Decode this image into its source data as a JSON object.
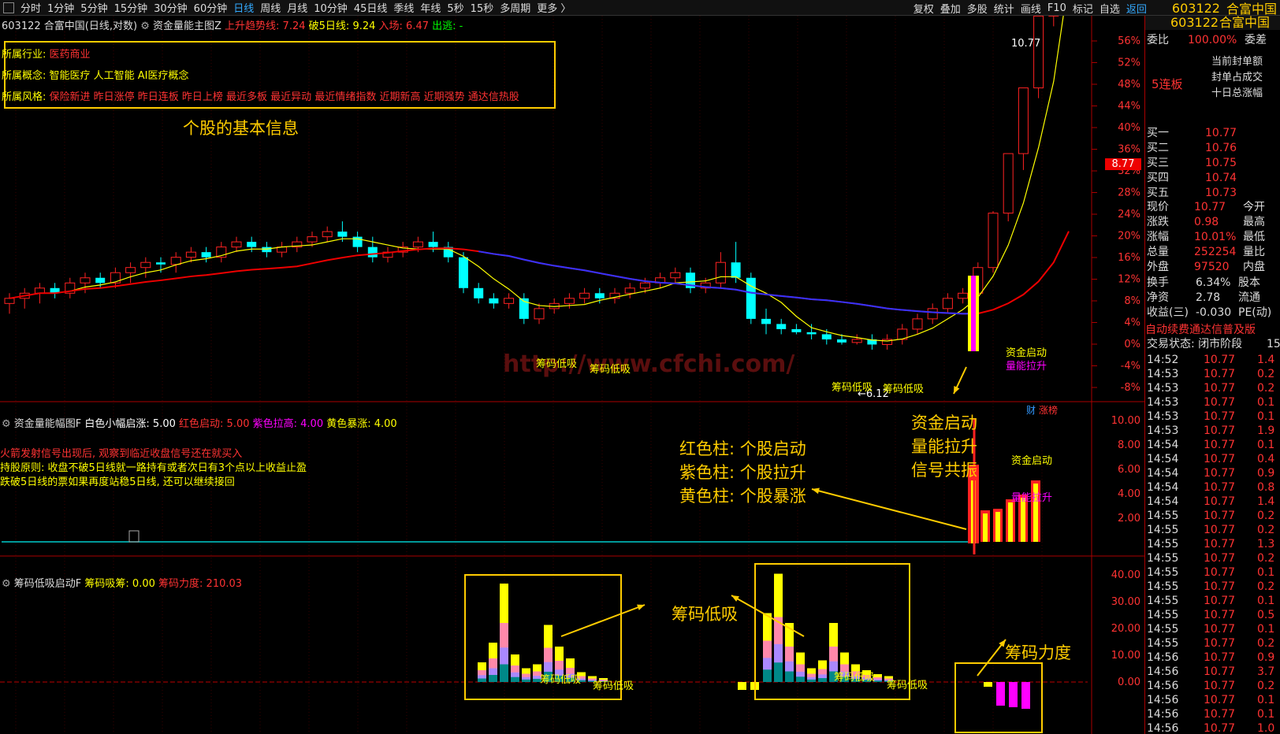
{
  "topbar": {
    "tabs": [
      "分时",
      "1分钟",
      "5分钟",
      "15分钟",
      "30分钟",
      "60分钟",
      "日线",
      "周线",
      "月线",
      "10分钟",
      "45日线",
      "季线",
      "年线",
      "5秒",
      "15秒",
      "多周期",
      "更多 〉"
    ],
    "active_tab": "日线",
    "tools": [
      "复权",
      "叠加",
      "多股",
      "统计",
      "画线",
      "F10",
      "标记",
      "自选",
      "返回"
    ],
    "stock_code": "603122",
    "stock_name": "合富中国"
  },
  "main_panel": {
    "header_code": "603122",
    "header_name": "合富中国(日线,对数)",
    "indicator_name": "资金量能主图Z",
    "up_trend_label": "上升趋势线: 7.24",
    "break5_label": "破5日线: 9.24",
    "entry_label": "入场: 6.47",
    "exit_label": "出逃: -",
    "info_lines": [
      {
        "label": "所属行业:",
        "value": "医药商业"
      },
      {
        "label": "所属概念:",
        "value": "智能医疗 人工智能 AI医疗概念"
      },
      {
        "label": "所属风格:",
        "value": "保险新进 昨日涨停 昨日连板 昨日上榜 最近多板 最近异动 最近情绪指数 近期新高 近期强势 通达信热股"
      }
    ],
    "info_caption": "个股的基本信息",
    "price_high_label": "10.77",
    "price_low_label": "←6.12",
    "price_marker": "8.77",
    "watermark": "http://www.cfchi.com/",
    "label_chip1": "筹码低吸",
    "label_chip2": "筹码低吸",
    "label_chip3": "筹码低吸",
    "label_chip4": "筹码低吸",
    "label_start": "资金启动",
    "label_lift": "量能拉升",
    "corner_tag1": "财",
    "corner_tag2": "涨榜"
  },
  "main_axis": [
    "56%",
    "52%",
    "48%",
    "44%",
    "40%",
    "36%",
    "32%",
    "28%",
    "24%",
    "20%",
    "16%",
    "12%",
    "8%",
    "4%",
    "0%",
    "-4%",
    "-8%"
  ],
  "mid_panel": {
    "title": "资金量能幅图F",
    "white_label": "白色小幅启涨: 5.00",
    "red_label": "红色启动: 5.00",
    "purple_label": "紫色拉高: 4.00",
    "yellow_label": "黄色暴涨: 4.00",
    "note1": "火箭发射信号出现后, 观察到临近收盘信号还在就买入",
    "note2": "持股原则: 收盘不破5日线就一路持有或者次日有3个点以上收益止盈",
    "note3": "跌破5日线的票如果再度站稳5日线, 还可以继续接回",
    "legend1": "红色柱: 个股启动",
    "legend2": "紫色柱: 个股拉升",
    "legend3": "黄色柱: 个股暴涨",
    "callout1": "资金启动",
    "callout2": "量能拉升",
    "callout3": "信号共振",
    "signal_start": "资金启动",
    "signal_lift": "量能拉升",
    "axis": [
      "10.00",
      "8.00",
      "6.00",
      "4.00",
      "2.00"
    ]
  },
  "low_panel": {
    "title": "筹码低吸启动F",
    "absorb_label": "筹码吸筹: 0.00",
    "force_label": "筹码力度: 210.03",
    "callout_absorb": "筹码低吸",
    "callout_force": "筹码力度",
    "inner_label1": "筹码低吸",
    "inner_label2": "筹码低吸",
    "inner_label3": "筹码低吸",
    "inner_label4": "筹码低吸",
    "axis": [
      "40.00",
      "30.00",
      "20.00",
      "10.00",
      "0.00"
    ]
  },
  "right_panel": {
    "code": "603122",
    "name": "合富中国",
    "weibi_label": "委比",
    "weibi_value": "100.00%",
    "weicha_label": "委差",
    "seal_amount": "当前封单额",
    "seal_ratio": "封单占成交",
    "ten_day": "十日总涨幅",
    "board": "5连板",
    "bids": [
      {
        "label": "买一",
        "price": "10.77"
      },
      {
        "label": "买二",
        "price": "10.76"
      },
      {
        "label": "买三",
        "price": "10.75"
      },
      {
        "label": "买四",
        "price": "10.74"
      },
      {
        "label": "买五",
        "price": "10.73"
      }
    ],
    "stats": [
      {
        "k": "现价",
        "v": "10.77",
        "k2": "今开"
      },
      {
        "k": "涨跌",
        "v": "0.98",
        "k2": "最高"
      },
      {
        "k": "涨幅",
        "v": "10.01%",
        "k2": "最低"
      },
      {
        "k": "总量",
        "v": "252254",
        "k2": "量比"
      },
      {
        "k": "外盘",
        "v": "97520",
        "k2": "内盘"
      }
    ],
    "stats2": [
      {
        "k": "换手",
        "v": "6.34%",
        "k2": "股本"
      },
      {
        "k": "净资",
        "v": "2.78",
        "k2": "流通"
      },
      {
        "k": "收益(三)",
        "v": "-0.030",
        "k2": "PE(动)"
      }
    ],
    "ticker_msg": "自动续费通达信普及版",
    "trade_state": "交易状态: 闭市阶段",
    "trade_state_num": "15",
    "ticks": [
      {
        "t": "14:52",
        "p": "10.77",
        "v": "1.4"
      },
      {
        "t": "14:53",
        "p": "10.77",
        "v": "0.2"
      },
      {
        "t": "14:53",
        "p": "10.77",
        "v": "0.2"
      },
      {
        "t": "14:53",
        "p": "10.77",
        "v": "0.1"
      },
      {
        "t": "14:53",
        "p": "10.77",
        "v": "0.1"
      },
      {
        "t": "14:53",
        "p": "10.77",
        "v": "1.9"
      },
      {
        "t": "14:54",
        "p": "10.77",
        "v": "0.1"
      },
      {
        "t": "14:54",
        "p": "10.77",
        "v": "0.4"
      },
      {
        "t": "14:54",
        "p": "10.77",
        "v": "0.9"
      },
      {
        "t": "14:54",
        "p": "10.77",
        "v": "0.8"
      },
      {
        "t": "14:54",
        "p": "10.77",
        "v": "1.4"
      },
      {
        "t": "14:55",
        "p": "10.77",
        "v": "0.2"
      },
      {
        "t": "14:55",
        "p": "10.77",
        "v": "0.2"
      },
      {
        "t": "14:55",
        "p": "10.77",
        "v": "1.3"
      },
      {
        "t": "14:55",
        "p": "10.77",
        "v": "0.2"
      },
      {
        "t": "14:55",
        "p": "10.77",
        "v": "0.1"
      },
      {
        "t": "14:55",
        "p": "10.77",
        "v": "0.2"
      },
      {
        "t": "14:55",
        "p": "10.77",
        "v": "0.1"
      },
      {
        "t": "14:55",
        "p": "10.77",
        "v": "0.5"
      },
      {
        "t": "14:55",
        "p": "10.77",
        "v": "0.1"
      },
      {
        "t": "14:55",
        "p": "10.77",
        "v": "0.2"
      },
      {
        "t": "14:56",
        "p": "10.77",
        "v": "0.9"
      },
      {
        "t": "14:56",
        "p": "10.77",
        "v": "3.7"
      },
      {
        "t": "14:56",
        "p": "10.77",
        "v": "0.2"
      },
      {
        "t": "14:56",
        "p": "10.77",
        "v": "0.1"
      },
      {
        "t": "14:56",
        "p": "10.77",
        "v": "0.1"
      },
      {
        "t": "14:56",
        "p": "10.77",
        "v": "1.0"
      }
    ]
  },
  "chart_data": {
    "type": "candlestick",
    "title": "603122 合富中国(日线,对数)",
    "ohlc": [
      [
        4.9,
        5.0,
        4.8,
        4.95
      ],
      [
        4.95,
        5.05,
        4.85,
        5.0
      ],
      [
        5.0,
        5.1,
        4.9,
        5.05
      ],
      [
        5.05,
        5.1,
        4.95,
        5.0
      ],
      [
        5.0,
        5.15,
        4.95,
        5.1
      ],
      [
        5.1,
        5.2,
        5.0,
        5.15
      ],
      [
        5.15,
        5.2,
        5.05,
        5.1
      ],
      [
        5.1,
        5.25,
        5.05,
        5.2
      ],
      [
        5.2,
        5.3,
        5.1,
        5.25
      ],
      [
        5.25,
        5.35,
        5.15,
        5.3
      ],
      [
        5.3,
        5.35,
        5.2,
        5.28
      ],
      [
        5.28,
        5.4,
        5.2,
        5.35
      ],
      [
        5.35,
        5.45,
        5.3,
        5.4
      ],
      [
        5.4,
        5.45,
        5.3,
        5.35
      ],
      [
        5.35,
        5.5,
        5.3,
        5.45
      ],
      [
        5.45,
        5.55,
        5.4,
        5.5
      ],
      [
        5.5,
        5.55,
        5.4,
        5.45
      ],
      [
        5.45,
        5.5,
        5.35,
        5.4
      ],
      [
        5.4,
        5.5,
        5.35,
        5.45
      ],
      [
        5.45,
        5.55,
        5.4,
        5.5
      ],
      [
        5.5,
        5.6,
        5.45,
        5.55
      ],
      [
        5.55,
        5.65,
        5.5,
        5.6
      ],
      [
        5.6,
        5.7,
        5.5,
        5.55
      ],
      [
        5.55,
        5.6,
        5.4,
        5.45
      ],
      [
        5.45,
        5.55,
        5.3,
        5.35
      ],
      [
        5.35,
        5.45,
        5.3,
        5.4
      ],
      [
        5.4,
        5.5,
        5.35,
        5.45
      ],
      [
        5.45,
        5.55,
        5.4,
        5.5
      ],
      [
        5.5,
        5.6,
        5.4,
        5.45
      ],
      [
        5.45,
        5.5,
        5.3,
        5.35
      ],
      [
        5.35,
        5.4,
        5.0,
        5.05
      ],
      [
        5.05,
        5.1,
        4.9,
        4.95
      ],
      [
        4.95,
        5.0,
        4.85,
        4.9
      ],
      [
        4.9,
        5.0,
        4.85,
        4.95
      ],
      [
        4.95,
        5.0,
        4.7,
        4.75
      ],
      [
        4.75,
        4.9,
        4.7,
        4.85
      ],
      [
        4.85,
        4.95,
        4.8,
        4.9
      ],
      [
        4.9,
        5.0,
        4.85,
        4.95
      ],
      [
        4.95,
        5.05,
        4.9,
        5.0
      ],
      [
        5.0,
        5.05,
        4.9,
        4.95
      ],
      [
        4.95,
        5.05,
        4.9,
        5.0
      ],
      [
        5.0,
        5.1,
        4.95,
        5.05
      ],
      [
        5.05,
        5.15,
        5.0,
        5.1
      ],
      [
        5.1,
        5.2,
        5.05,
        5.15
      ],
      [
        5.15,
        5.25,
        5.1,
        5.2
      ],
      [
        5.2,
        5.25,
        5.0,
        5.05
      ],
      [
        5.05,
        5.15,
        5.0,
        5.1
      ],
      [
        5.1,
        5.4,
        5.05,
        5.3
      ],
      [
        5.3,
        5.5,
        5.1,
        5.15
      ],
      [
        5.15,
        5.2,
        4.7,
        4.75
      ],
      [
        4.75,
        4.85,
        4.6,
        4.7
      ],
      [
        4.7,
        4.75,
        4.6,
        4.65
      ],
      [
        4.65,
        4.7,
        4.6,
        4.62
      ],
      [
        4.62,
        4.7,
        4.55,
        4.6
      ],
      [
        4.6,
        4.65,
        4.5,
        4.55
      ],
      [
        4.55,
        4.6,
        4.5,
        4.52
      ],
      [
        4.52,
        4.6,
        4.5,
        4.55
      ],
      [
        4.55,
        4.6,
        4.45,
        4.5
      ],
      [
        4.5,
        4.6,
        4.45,
        4.55
      ],
      [
        4.55,
        4.7,
        4.5,
        4.65
      ],
      [
        4.65,
        4.8,
        4.6,
        4.75
      ],
      [
        4.75,
        4.9,
        4.7,
        4.85
      ],
      [
        4.85,
        5.0,
        4.8,
        4.95
      ],
      [
        4.95,
        5.05,
        4.9,
        5.0
      ],
      [
        5.0,
        5.3,
        4.95,
        5.25
      ],
      [
        5.25,
        5.8,
        5.2,
        5.78
      ],
      [
        5.78,
        6.36,
        5.7,
        6.36
      ],
      [
        6.36,
        7.0,
        6.2,
        7.0
      ],
      [
        7.0,
        7.7,
        6.9,
        7.7
      ],
      [
        7.7,
        8.47,
        7.6,
        8.47
      ],
      [
        10.77,
        10.77,
        10.77,
        10.77
      ]
    ],
    "y_axis_pct": [
      "56%",
      "52%",
      "48%",
      "44%",
      "40%",
      "36%",
      "32%",
      "28%",
      "24%",
      "20%",
      "16%",
      "12%",
      "8%",
      "4%",
      "0%",
      "-4%",
      "-8%"
    ],
    "high_label": 10.77,
    "low_label": 6.12,
    "subcharts": [
      {
        "name": "资金量能幅图F",
        "ylim": [
          0,
          10
        ],
        "series": [
          {
            "name": "红色启动",
            "values": [
              5.0
            ]
          },
          {
            "name": "紫色拉高",
            "values": [
              4.0
            ]
          },
          {
            "name": "黄色暴涨",
            "values": [
              4.0
            ]
          }
        ]
      },
      {
        "name": "筹码低吸启动F",
        "ylim": [
          0,
          40
        ],
        "series": [
          {
            "name": "筹码吸筹",
            "values": [
              0.0
            ]
          },
          {
            "name": "筹码力度",
            "values": [
              210.03
            ]
          }
        ]
      }
    ]
  }
}
